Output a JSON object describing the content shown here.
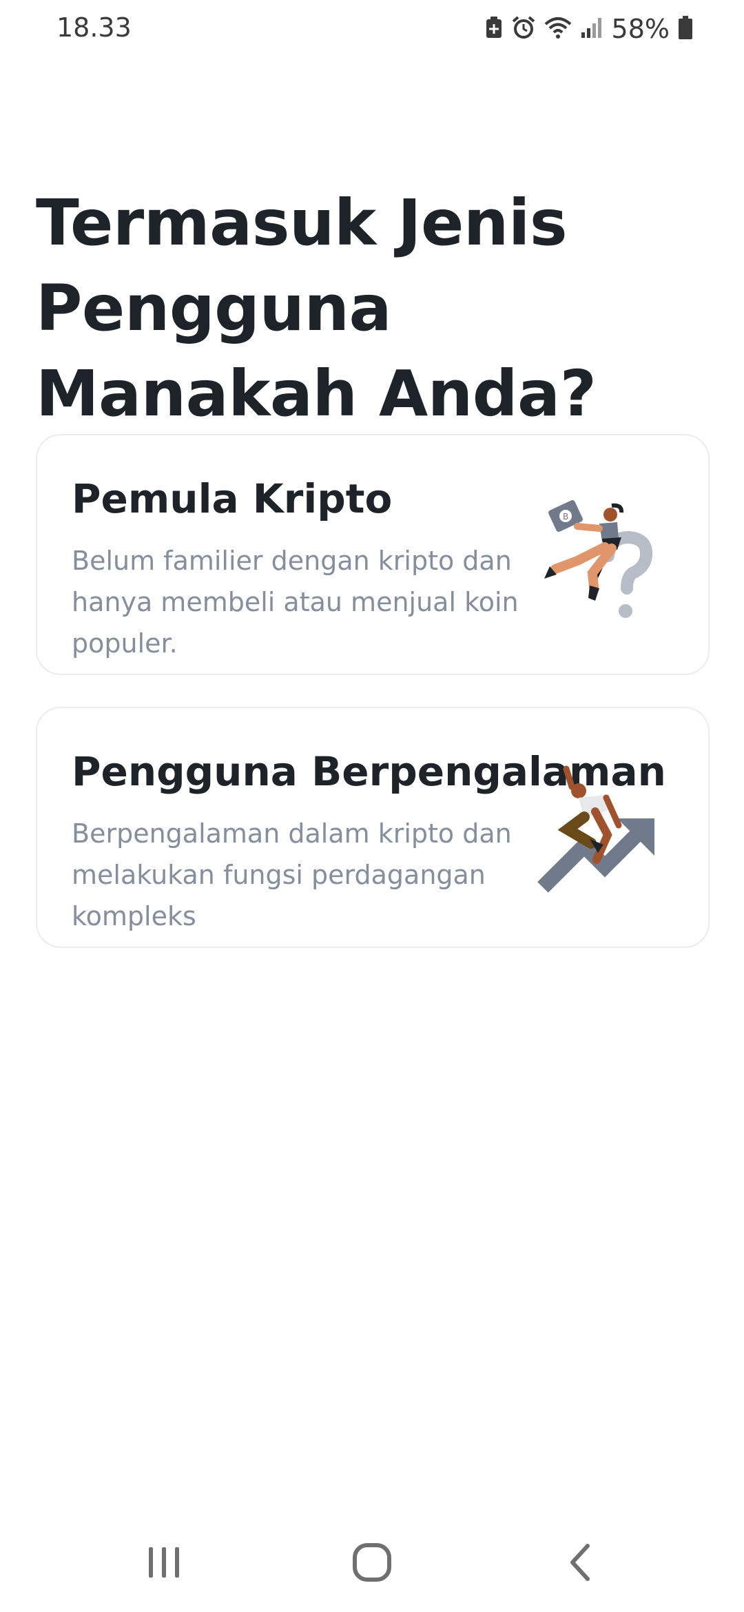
{
  "status_bar": {
    "time": "18.33",
    "battery": "58%",
    "icons": [
      "battery-saver-icon",
      "alarm-icon",
      "wifi-icon",
      "signal-icon",
      "battery-icon"
    ]
  },
  "page": {
    "title": "Termasuk Jenis Pengguna Manakah Anda?"
  },
  "options": [
    {
      "title": "Pemula Kripto",
      "description": "Belum familier dengan kripto dan hanya membeli atau menjual koin populer.",
      "illustration": "beginner-illustration"
    },
    {
      "title": "Pengguna Berpengalaman",
      "description": "Berpengalaman dalam kripto dan melakukan fungsi perdagangan kompleks",
      "illustration": "experienced-illustration"
    }
  ],
  "nav_bar": {
    "icons": [
      "recents-icon",
      "home-icon",
      "back-icon"
    ]
  },
  "colors": {
    "title": "#1e2329",
    "description": "#848e9c",
    "card_border": "#eaecef",
    "background": "#ffffff"
  }
}
